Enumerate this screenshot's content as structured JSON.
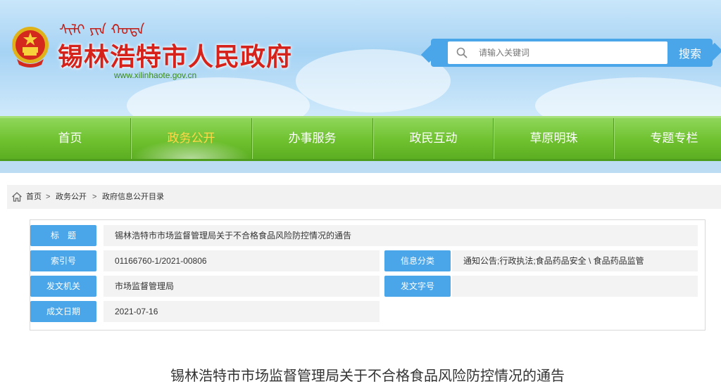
{
  "header": {
    "mongolian": "ᠰᠢᠯᠢ ᠶᠢᠨ ᠬᠣᠲᠠ",
    "title": "锡林浩特市人民政府",
    "url": "www.xilinhaote.gov.cn"
  },
  "search": {
    "placeholder": "请输入关键词",
    "button_label": "搜索"
  },
  "nav": {
    "items": [
      {
        "label": "首页"
      },
      {
        "label": "政务公开"
      },
      {
        "label": "办事服务"
      },
      {
        "label": "政民互动"
      },
      {
        "label": "草原明珠"
      },
      {
        "label": "专题专栏"
      }
    ],
    "active_index": 1
  },
  "breadcrumb": {
    "items": [
      "首页",
      "政务公开",
      "政府信息公开目录"
    ],
    "separator": ">"
  },
  "meta": {
    "title_label": "标　题",
    "title_value": "锡林浩特市市场监督管理局关于不合格食品风险防控情况的通告",
    "index_label": "索引号",
    "index_value": "01166760-1/2021-00806",
    "category_label": "信息分类",
    "category_value": "通知公告;行政执法;食品药品安全 \\ 食品药品监管",
    "issuer_label": "发文机关",
    "issuer_value": "市场监督管理局",
    "docno_label": "发文字号",
    "docno_value": "",
    "date_label": "成文日期",
    "date_value": "2021-07-16"
  },
  "article": {
    "title": "锡林浩特市市场监督管理局关于不合格食品风险防控情况的通告"
  },
  "colors": {
    "accent_blue": "#4aa6e8",
    "nav_green": "#6fc12f",
    "title_red": "#d5231c",
    "active_yellow": "#ffd84a"
  }
}
